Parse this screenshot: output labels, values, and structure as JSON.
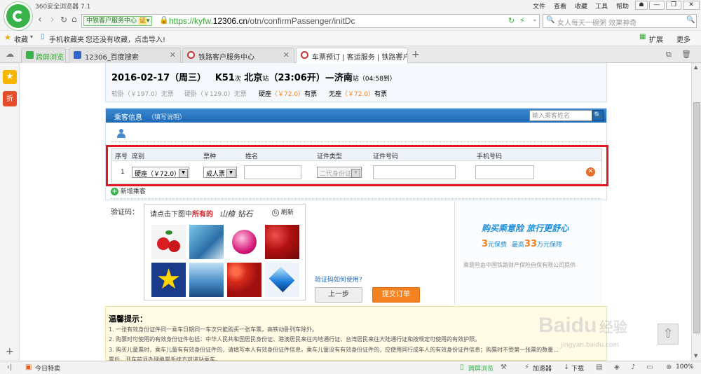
{
  "browser": {
    "title": "360安全浏览器 7.1",
    "menu": [
      "文件",
      "查看",
      "收藏",
      "工具",
      "帮助"
    ],
    "site_badge": "中铁客户服务中心",
    "cert_badge": "证",
    "url_prefix": "https://kyfw.",
    "url_domain": "12306.cn",
    "url_path": "/otn/confirmPassenger/initDc",
    "search_text": "女人每天一碗粥 效果神奇",
    "fav": {
      "label": "收藏",
      "mobile": "手机收藏夹",
      "import_hint": "您还没有收藏，点击导入!"
    },
    "ext": {
      "label": "扩展",
      "more": "更多"
    },
    "tabs": [
      {
        "label": "跨屏浏览"
      },
      {
        "label": "12306_百度搜索"
      },
      {
        "label": "铁路客户服务中心"
      },
      {
        "label": "车票预订 | 客运服务 | 铁路客户服..."
      }
    ],
    "status": {
      "today": "今日特卖",
      "cross": "跨屏浏览",
      "accel": "加速器",
      "download": "下载",
      "zoom": "100%"
    },
    "side_badge": "折"
  },
  "train": {
    "date": "2016-02-17（周三）",
    "number": "K51",
    "ci": "次",
    "from": "北京",
    "zhan1": "站",
    "dep_time": "（23:06开）",
    "dash": "—",
    "to": "济南",
    "zhan2": "站",
    "arr": "（04:58到）",
    "seats": [
      {
        "name": "软卧",
        "price": "（￥197.0）",
        "status": "无票"
      },
      {
        "name": "硬卧",
        "price": "（￥129.0）",
        "status": "无票"
      },
      {
        "name": "硬座",
        "price": "（￥72.0）",
        "status": "有票"
      },
      {
        "name": "无座",
        "price": "（￥72.0）",
        "status": "有票"
      }
    ]
  },
  "passenger": {
    "section_title": "乘客信息",
    "section_note": "（填写说明）",
    "search_placeholder": "输入乘客姓名",
    "headers": [
      "序号",
      "席别",
      "票种",
      "姓名",
      "证件类型",
      "证件号码",
      "手机号码"
    ],
    "row": {
      "index": "1",
      "seat": "硬座（￥72.0）",
      "ticket": "成人票",
      "id_type": "二代身份证"
    },
    "add_label": "新增乘客"
  },
  "captcha": {
    "label": "验证码：",
    "prompt_pre": "请点击下图中",
    "prompt_em": "所有的",
    "word": "山楂  钻石",
    "refresh": "刷新",
    "how": "验证码如何使用?",
    "prev": "上一步",
    "submit": "提交订单"
  },
  "ad": {
    "title": "购买乘意险  旅行更舒心",
    "num1": "3",
    "unit1": "元保费",
    "mid": "最高",
    "num2": "33",
    "unit2": "万元保障",
    "footer": "乘意险由中国铁路财产保险自保有限公司提供"
  },
  "tips": {
    "title": "温馨提示：",
    "items": [
      "1. 一张有效身份证件同一乘车日期同一车次只能购买一张车票，高铁动卧列车除外。",
      "2. 购票时可使用的有效身份证件包括：中华人民共和国居民身份证、港澳居民来往内地通行证、台湾居民来往大陆通行证和按规定可使用的有效护照。",
      "3. 购买儿童票时，乘车儿童有有效身份证件的，请填写本人有效身份证件信息。乘车儿童没有有效身份证件的，应使用同行成年人的有效身份证件信息；购票时不受第一张票的数量...",
      "票后，开车前须办理换票手续方可进站乘车。"
    ]
  },
  "watermark": {
    "brand": "Baidu",
    "sub": "经验",
    "url": "jingyan.baidu.com"
  },
  "colors": {
    "accent": "#1f6ab2",
    "orange": "#f58220",
    "red_box": "#e0181f",
    "green": "#37b34a"
  }
}
